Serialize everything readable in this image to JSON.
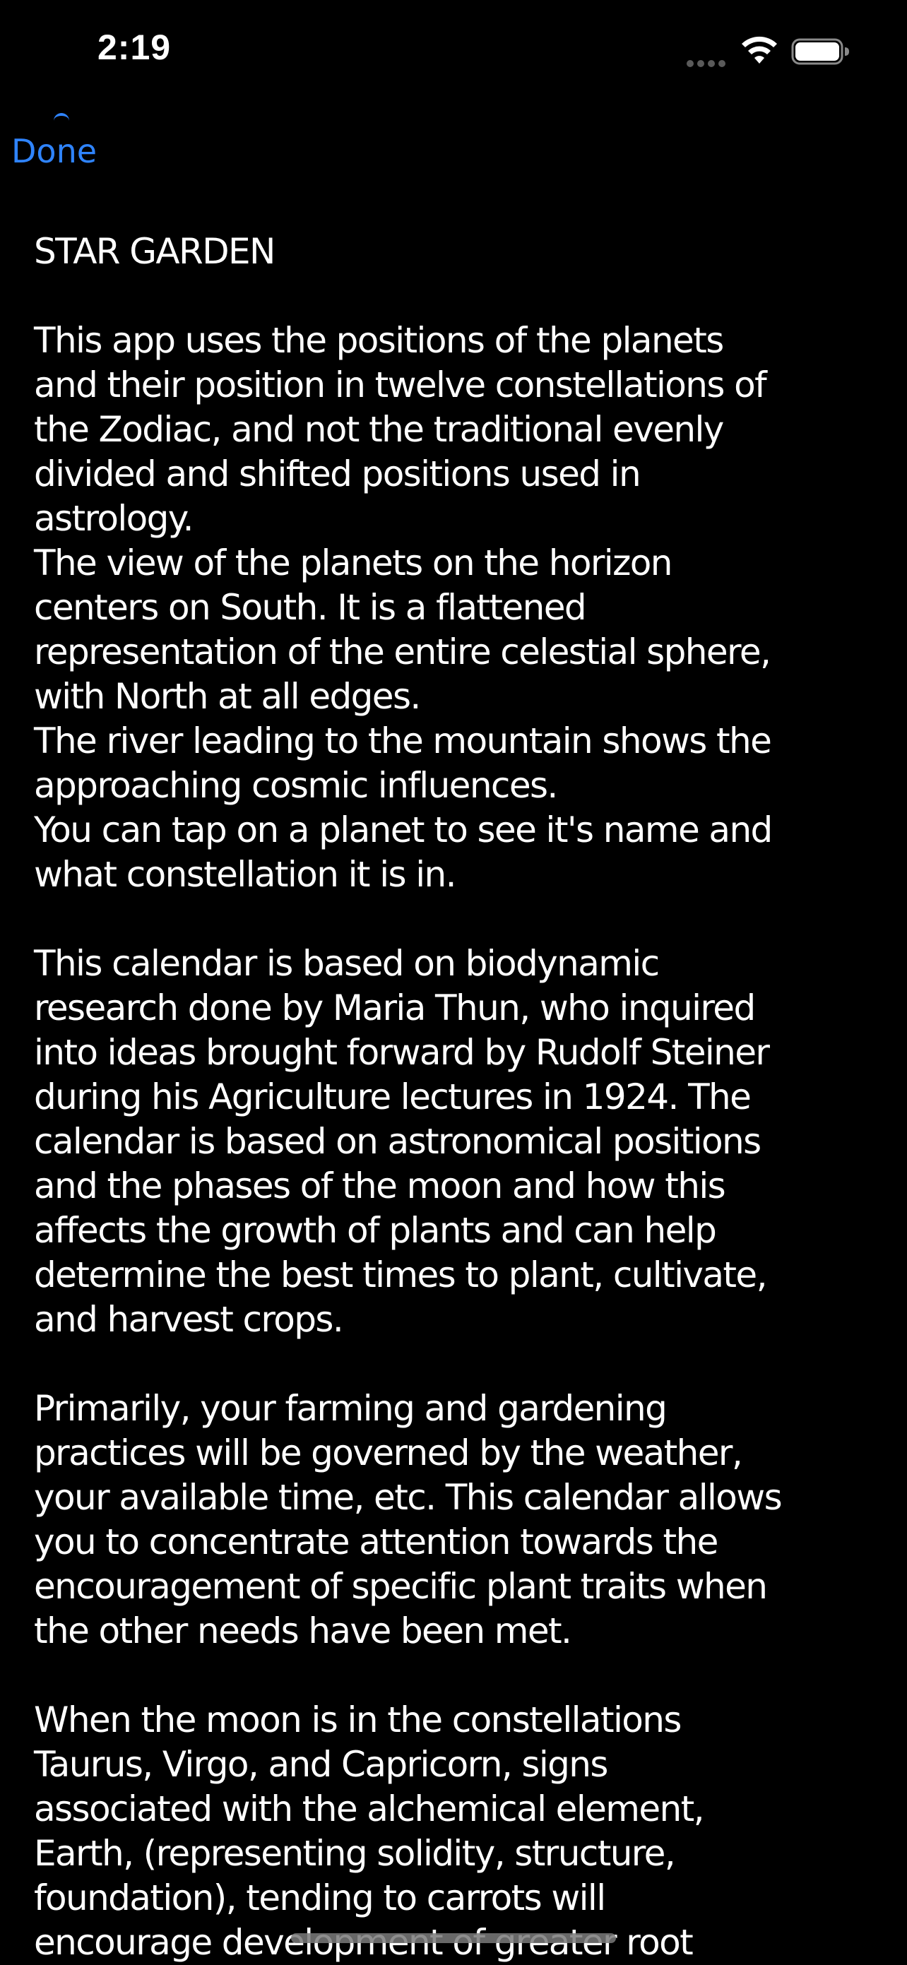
{
  "status_bar": {
    "time": "2:19"
  },
  "nav": {
    "done_label": "Done"
  },
  "article": {
    "title": "STAR GARDEN",
    "p1": [
      "This app uses the positions of the planets",
      "and their position in twelve constellations of",
      "the Zodiac, and not the traditional evenly",
      "divided and shifted positions used in",
      "astrology.",
      "The view of the planets on the horizon",
      "centers on South. It is a flattened",
      "representation of the entire celestial sphere,",
      "with North at all edges.",
      "The river leading to the mountain shows the",
      "approaching cosmic influences.",
      "You can tap on a planet to see it's name and",
      "what constellation it is in."
    ],
    "p2": [
      "This calendar is based on biodynamic",
      "research done by Maria Thun, who inquired",
      "into ideas brought forward by Rudolf Steiner",
      "during his Agriculture lectures in 1924. The",
      "calendar is based on astronomical positions",
      "and the phases of the moon and how this",
      "affects the growth of plants and can help",
      "determine the best times to plant, cultivate,",
      "and harvest crops."
    ],
    "p3": [
      "Primarily, your farming and gardening",
      "practices will be governed by the weather,",
      "your available time, etc. This calendar allows",
      "you to concentrate attention towards the",
      "encouragement of specific plant traits when",
      "the other needs have been met."
    ],
    "p4": [
      "When the moon is in the constellations",
      "Taurus, Virgo, and Capricorn, signs",
      "associated with the alchemical element,",
      "Earth, (representing solidity, structure,",
      "foundation), tending to carrots will",
      "encourage development of greater root"
    ]
  },
  "colors": {
    "background": "#000000",
    "text": "#ffffff",
    "accent": "#2f84ff"
  },
  "icons": [
    "cellular-signal-icon",
    "wifi-icon",
    "battery-icon"
  ]
}
